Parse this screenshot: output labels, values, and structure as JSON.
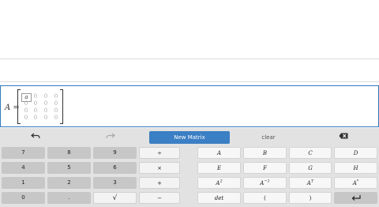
{
  "editor": {
    "label": "A =",
    "matrix": [
      [
        "a",
        "0",
        "0",
        "0"
      ],
      [
        "0",
        "0",
        "0",
        "0"
      ],
      [
        "0",
        "0",
        "0",
        "0"
      ],
      [
        "0",
        "0",
        "0",
        "0"
      ]
    ]
  },
  "toolbar": {
    "undo_icon": "undo-arrow-icon",
    "redo_icon": "redo-arrow-icon",
    "new_matrix": "New Matrix",
    "clear": "clear",
    "backspace_icon": "backspace-icon"
  },
  "keys": {
    "num": [
      "7",
      "8",
      "9",
      "4",
      "5",
      "6",
      "1",
      "2",
      "3",
      "0",
      "."
    ],
    "sqrt": "√",
    "ops": [
      "÷",
      "×",
      "+",
      "−"
    ],
    "vars": [
      "A",
      "B",
      "C",
      "D",
      "E",
      "F",
      "G",
      "H"
    ],
    "a2": "A",
    "a2sup": "2",
    "ainv": "A",
    "ainvsup": "−1",
    "at": "A",
    "atsup": "T",
    "astar": "A",
    "astarsup": "*",
    "det": "det",
    "lparen": "(",
    "rparen": ")",
    "enter_icon": "enter-return-icon"
  },
  "colors": {
    "accent": "#3b7fc4",
    "editor_border": "#2f79bd",
    "keyboard_bg": "#e2e2e2"
  }
}
